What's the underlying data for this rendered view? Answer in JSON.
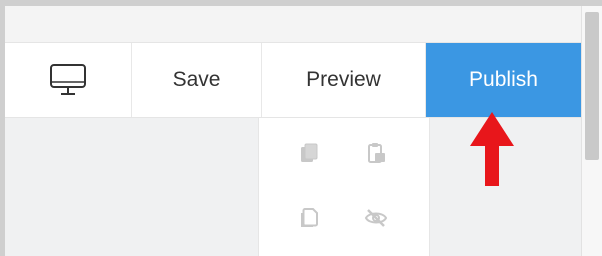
{
  "toolbar": {
    "device_icon": "desktop-monitor-icon",
    "save_label": "Save",
    "preview_label": "Preview",
    "publish_label": "Publish"
  },
  "panel": {
    "icons": [
      "copy-icon",
      "paste-icon",
      "duplicate-icon",
      "hide-eye-icon"
    ]
  },
  "annotation": {
    "arrow_icon": "red-arrow-up-icon"
  },
  "colors": {
    "publish_bg": "#3b97e3",
    "arrow": "#e8161b",
    "panel_icon": "#c8c8c8",
    "content_bg": "#f0f1f2"
  }
}
